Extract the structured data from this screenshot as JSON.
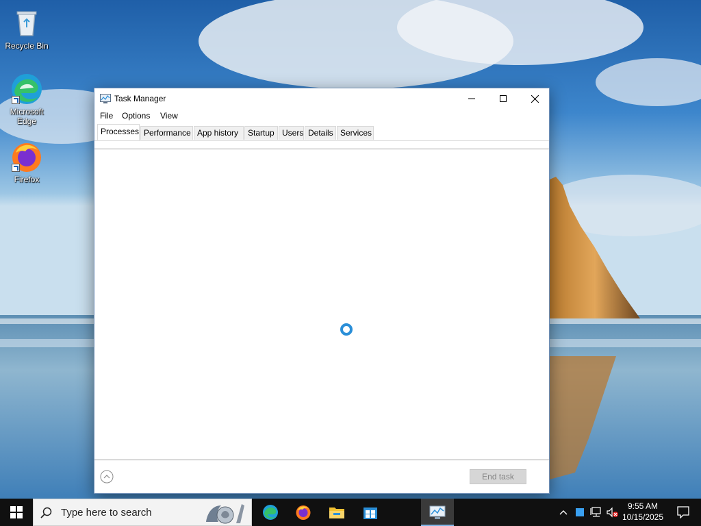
{
  "desktop": {
    "icons": [
      {
        "label": "Recycle Bin"
      },
      {
        "label": "Microsoft Edge"
      },
      {
        "label": "Firefox"
      }
    ]
  },
  "window": {
    "title": "Task Manager",
    "menu": [
      "File",
      "Options",
      "View"
    ],
    "tabs": [
      "Processes",
      "Performance",
      "App history",
      "Startup",
      "Users",
      "Details",
      "Services"
    ],
    "active_tab": "Processes",
    "end_task_label": "End task",
    "end_task_enabled": false,
    "content_state": "loading"
  },
  "taskbar": {
    "search_placeholder": "Type here to search",
    "apps": [
      "edge-icon",
      "firefox-icon",
      "file-explorer-icon",
      "store-icon",
      "task-manager-icon"
    ],
    "clock_time": "9:55 AM",
    "clock_date": "10/15/2025"
  },
  "colors": {
    "accent": "#2b8fd8",
    "taskbar": "#101010",
    "spinner": "#2b8fd8"
  }
}
